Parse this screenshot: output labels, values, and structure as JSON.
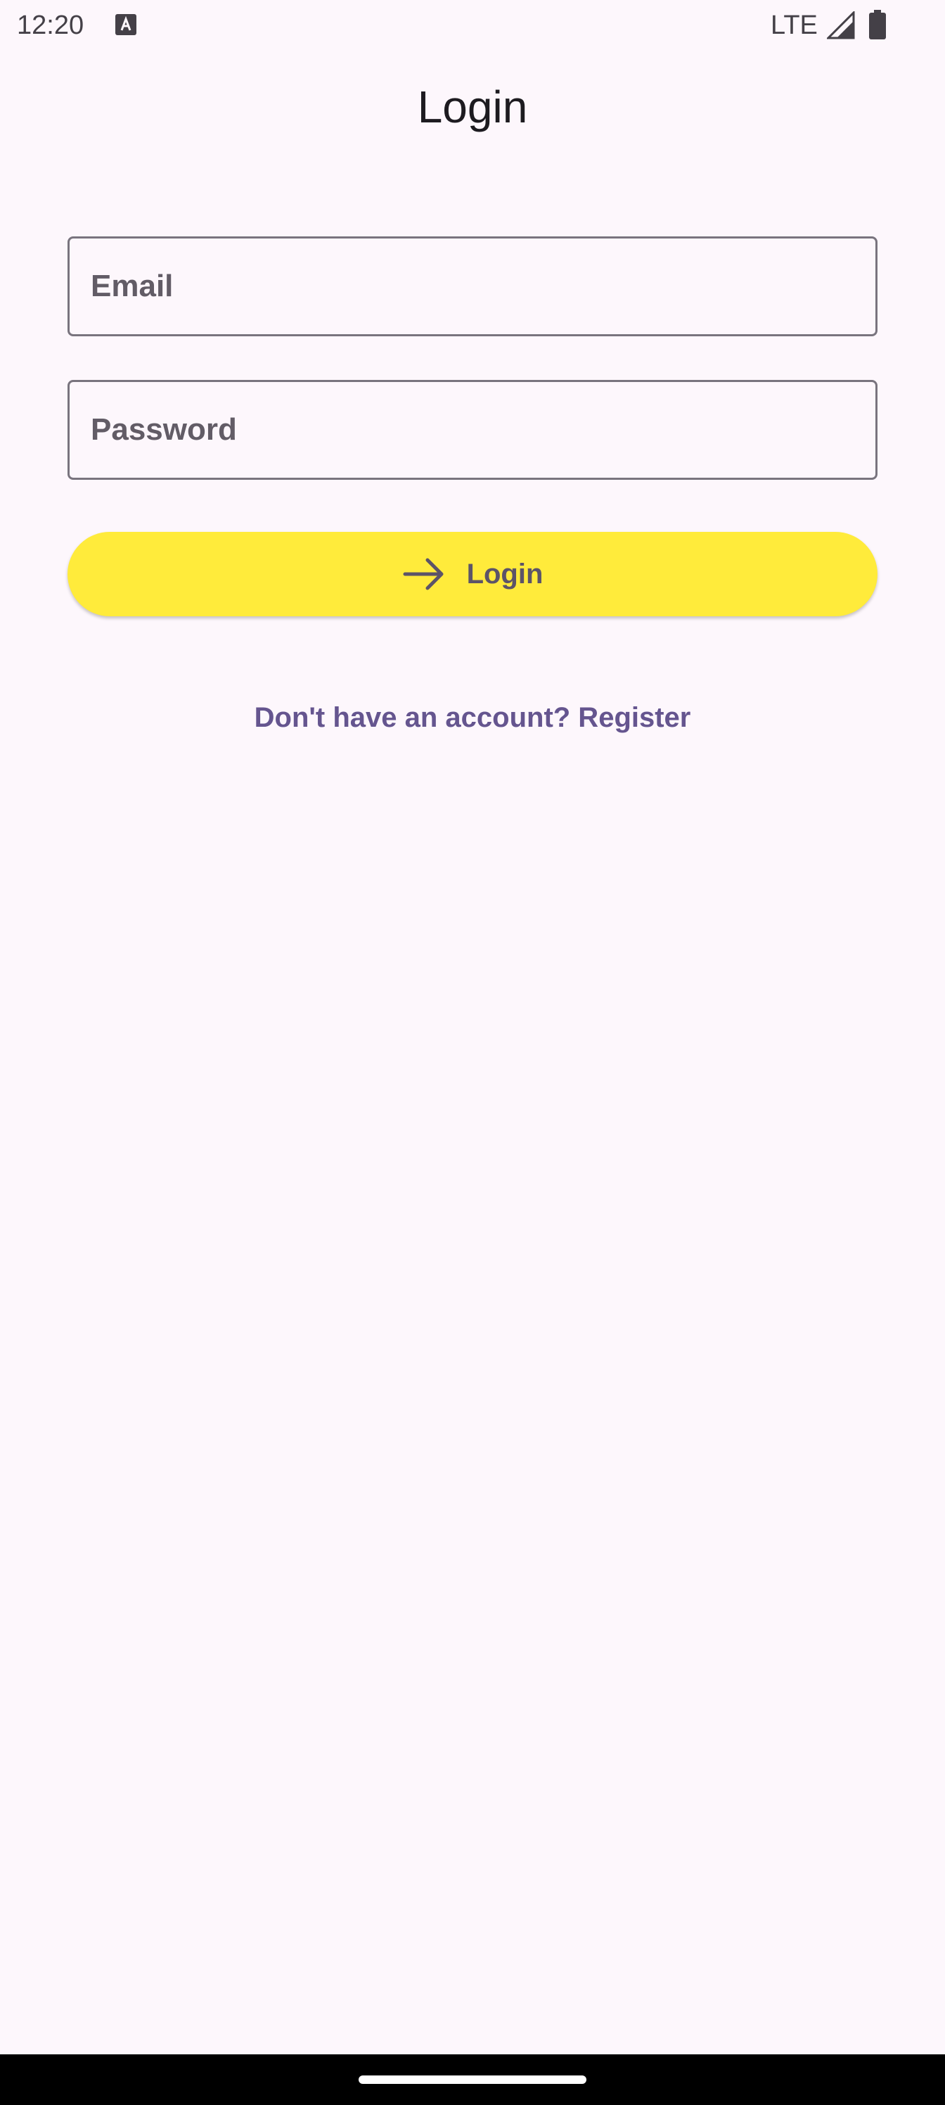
{
  "status_bar": {
    "time": "12:20",
    "network": "LTE",
    "icons": [
      "keyboard-a-icon",
      "signal-icon",
      "battery-icon"
    ]
  },
  "page": {
    "title": "Login"
  },
  "form": {
    "email_placeholder": "Email",
    "email_value": "",
    "password_placeholder": "Password",
    "password_value": "",
    "login_label": "Login",
    "login_icon": "arrow-right-icon",
    "register_text": "Don't have an account? Register"
  },
  "colors": {
    "background": "#fdf7fc",
    "button": "#ffeb3b",
    "button_text": "#5c5468",
    "link": "#65558f",
    "field_border": "#79747e"
  }
}
